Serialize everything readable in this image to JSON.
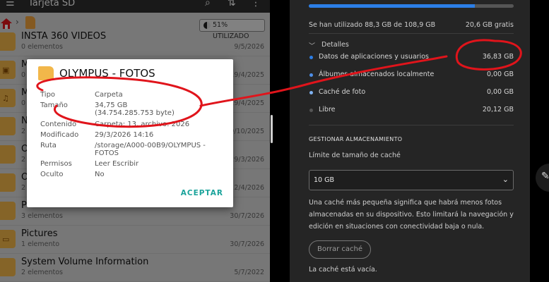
{
  "file_manager": {
    "app_title": "Tarjeta SD",
    "usage_badge": "51% UTILIZADO",
    "rows": [
      {
        "name": "INSTA 360 VIDEOS",
        "sub": "0 elementos",
        "date": "9/5/2026",
        "glyph": ""
      },
      {
        "name": "M",
        "sub": "0",
        "date": "19/4/2025",
        "glyph": "▣"
      },
      {
        "name": "M",
        "sub": "0",
        "date": "19/4/2025",
        "glyph": "♫"
      },
      {
        "name": "N",
        "sub": "2",
        "date": "19/10/2025",
        "glyph": ""
      },
      {
        "name": "O",
        "sub": "2",
        "date": "29/3/2026",
        "glyph": ""
      },
      {
        "name": "O",
        "sub": "2",
        "date": "12/4/2026",
        "glyph": ""
      },
      {
        "name": "P",
        "sub": "3 elementos",
        "date": "30/7/2026",
        "glyph": ""
      },
      {
        "name": "Pictures",
        "sub": "1 elemento",
        "date": "30/7/2026",
        "glyph": "▭"
      },
      {
        "name": "System Volume Information",
        "sub": "2 elementos",
        "date": "5/7/2022",
        "glyph": ""
      }
    ]
  },
  "dialog": {
    "title": "OLYMPUS - FOTOS",
    "props": [
      {
        "label": "Tipo",
        "value": "Carpeta"
      },
      {
        "label": "Tamaño",
        "value": "34,75 GB"
      },
      {
        "label": "",
        "value": "(34.754.285.753 byte)"
      },
      {
        "label": "Contenido",
        "value": "Carpeta: 13, archivo: 2026"
      },
      {
        "label": "Modificado",
        "value": "29/3/2026 14:16"
      },
      {
        "label": "Ruta",
        "value": "/storage/A000-00B9/OLYMPUS -"
      },
      {
        "label": "",
        "value": "FOTOS"
      },
      {
        "label": "Permisos",
        "value": "Leer Escribir"
      },
      {
        "label": "Oculto",
        "value": "No"
      }
    ],
    "accept_label": "ACEPTAR"
  },
  "cache_settings": {
    "storage_used_fraction": 0.81,
    "used_text": "Se han utilizado 88,3 GB de 108,9 GB",
    "free_text": "20,6 GB gratis",
    "details_label": "Detalles",
    "items": [
      {
        "label": "Datos de aplicaciones y usuarios",
        "amount": "36,83 GB",
        "color": "#2c7ee6"
      },
      {
        "label": "Álbumes almacenados localmente",
        "amount": "0,00 GB",
        "color": "#4d8fe9"
      },
      {
        "label": "Caché de foto",
        "amount": "0,00 GB",
        "color": "#7fb2f2"
      },
      {
        "label": "Libre",
        "amount": "20,12 GB",
        "color": "#555555"
      }
    ],
    "section_title": "GESTIONAR ALMACENAMIENTO",
    "limit_label": "Límite de tamaño de caché",
    "selected_limit": "10 GB",
    "description": "Una caché más pequeña significa que habrá menos fotos almacenadas en su dispositivo. Esto limitará la navegación y edición en situaciones con conectividad baja o nula.",
    "clear_button": "Borrar caché",
    "empty_text": "La caché está vacía."
  },
  "colors": {
    "accent_teal": "#1aa39b",
    "annotation_red": "#e0141b",
    "storage_blue": "#2c7ee6"
  }
}
